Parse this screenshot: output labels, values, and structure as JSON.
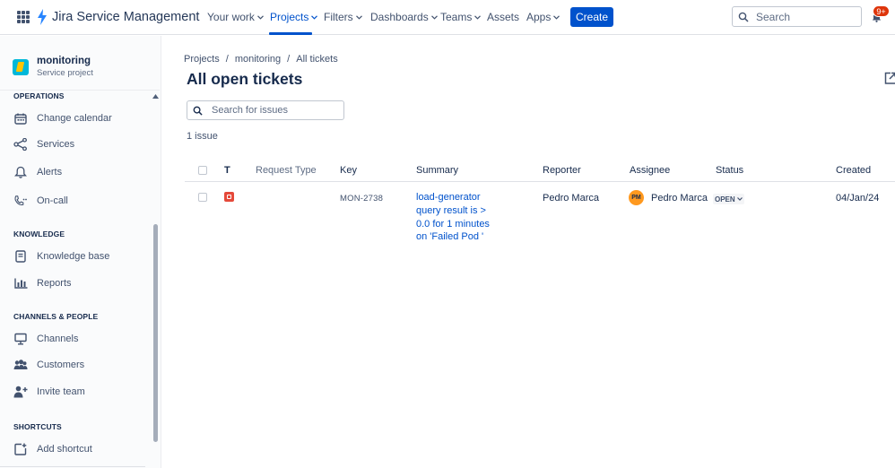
{
  "topnav": {
    "product": "Jira Service Management",
    "items": [
      {
        "label": "Your work",
        "dropdown": true
      },
      {
        "label": "Projects",
        "dropdown": true,
        "active": true
      },
      {
        "label": "Filters",
        "dropdown": true
      },
      {
        "label": "Dashboards",
        "dropdown": true
      },
      {
        "label": "Teams",
        "dropdown": true
      },
      {
        "label": "Assets",
        "dropdown": false
      },
      {
        "label": "Apps",
        "dropdown": true
      }
    ],
    "create_label": "Create",
    "search_placeholder": "Search",
    "notifications_badge": "9+"
  },
  "sidebar": {
    "project_name": "monitoring",
    "project_type": "Service project",
    "sections": [
      {
        "title": "OPERATIONS",
        "items": [
          {
            "label": "Change calendar",
            "icon": "calendar-icon"
          },
          {
            "label": "Services",
            "icon": "services-icon"
          },
          {
            "label": "Alerts",
            "icon": "bell-icon"
          },
          {
            "label": "On-call",
            "icon": "phone-icon"
          }
        ]
      },
      {
        "title": "KNOWLEDGE",
        "items": [
          {
            "label": "Knowledge base",
            "icon": "book-icon"
          },
          {
            "label": "Reports",
            "icon": "chart-icon"
          }
        ]
      },
      {
        "title": "CHANNELS & PEOPLE",
        "items": [
          {
            "label": "Channels",
            "icon": "monitor-icon"
          },
          {
            "label": "Customers",
            "icon": "people-icon"
          },
          {
            "label": "Invite team",
            "icon": "person-add-icon"
          }
        ]
      },
      {
        "title": "SHORTCUTS",
        "items": [
          {
            "label": "Add shortcut",
            "icon": "add-shortcut-icon"
          }
        ]
      }
    ]
  },
  "main": {
    "breadcrumb": [
      "Projects",
      "monitoring",
      "All tickets"
    ],
    "breadcrumb_sep": "/",
    "title": "All open tickets",
    "search_placeholder": "Search for issues",
    "issue_count": "1 issue",
    "columns": [
      "T",
      "Request Type",
      "Key",
      "Summary",
      "Reporter",
      "Assignee",
      "Status",
      "Created"
    ],
    "rows": [
      {
        "type_icon": "incident-icon",
        "request_type": "",
        "key": "MON-2738",
        "summary": "load-generator query result is > 0.0 for 1 minutes on 'Failed Pod '",
        "reporter": "Pedro Marca",
        "assignee_initials": "PM",
        "assignee": "Pedro Marca",
        "status": "OPEN",
        "created": "04/Jan/24"
      }
    ]
  },
  "colors": {
    "accent": "#0052cc",
    "incident": "#e5493a",
    "avatar": "#ff991f",
    "badge": "#de350b"
  }
}
